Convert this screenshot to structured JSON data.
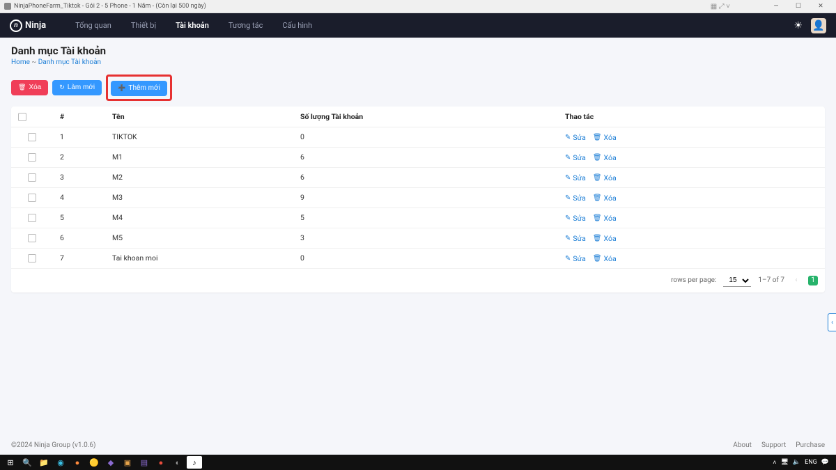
{
  "window": {
    "title": "NinjaPhoneFarm_Tiktok - Gói 2 - 5 Phone - 1 Năm - (Còn lại 500 ngày)"
  },
  "header": {
    "brand": "Ninja",
    "nav": [
      "Tổng quan",
      "Thiết bị",
      "Tài khoản",
      "Tương tác",
      "Cấu hình"
    ],
    "active_index": 2
  },
  "page": {
    "title": "Danh mục Tài khoản",
    "breadcrumb_home": "Home",
    "breadcrumb_sep": "~",
    "breadcrumb_current": "Danh mục Tài khoản"
  },
  "toolbar": {
    "delete_label": "Xóa",
    "refresh_label": "Làm mới",
    "add_label": "Thêm mới"
  },
  "table": {
    "headers": {
      "num": "#",
      "name": "Tên",
      "qty": "Số lượng Tài khoản",
      "actions": "Thao tác"
    },
    "rows": [
      {
        "num": 1,
        "name": "TIKTOK",
        "qty": 0
      },
      {
        "num": 2,
        "name": "M1",
        "qty": 6
      },
      {
        "num": 3,
        "name": "M2",
        "qty": 6
      },
      {
        "num": 4,
        "name": "M3",
        "qty": 9
      },
      {
        "num": 5,
        "name": "M4",
        "qty": 5
      },
      {
        "num": 6,
        "name": "M5",
        "qty": 3
      },
      {
        "num": 7,
        "name": "Tai khoan moi",
        "qty": 0
      }
    ],
    "action_edit": "Sửa",
    "action_delete": "Xóa"
  },
  "pagination": {
    "rows_per_page_label": "rows per page:",
    "rows_per_page_value": "15",
    "range_label": "1–7 of 7",
    "current_page": "1"
  },
  "footer": {
    "copyright": "©2024 Ninja Group (v1.0.6)",
    "links": [
      "About",
      "Support",
      "Purchase"
    ]
  },
  "taskbar": {
    "tray_lang": "ENG",
    "tray_speaker_icon": "speaker",
    "tray_wifi_icon": "wifi"
  }
}
